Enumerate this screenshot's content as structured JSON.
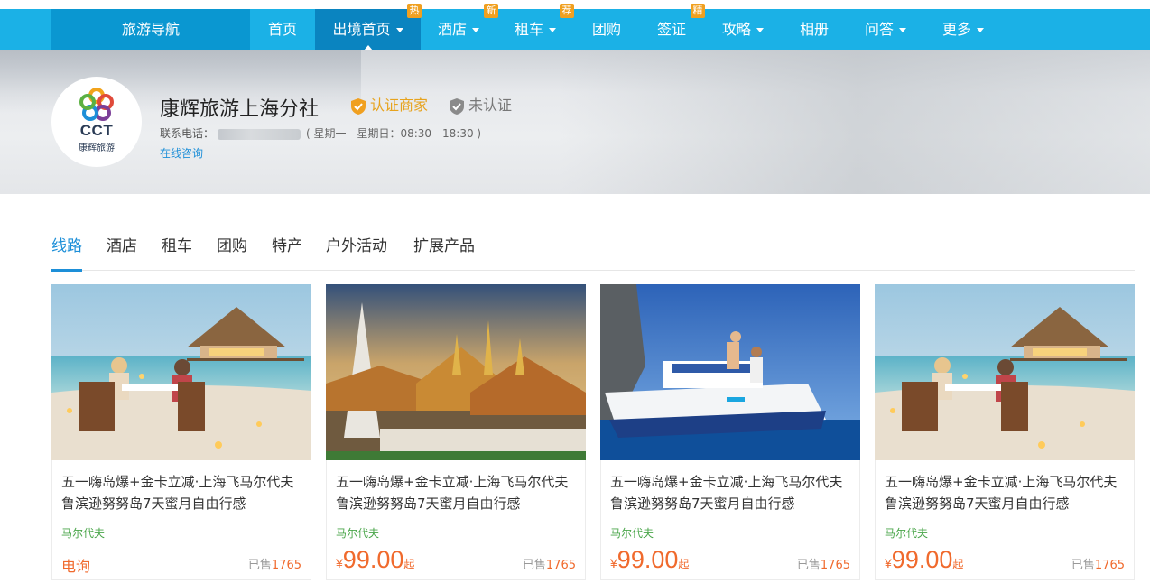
{
  "nav": {
    "brand": "旅游导航",
    "items": [
      {
        "label": "首页",
        "dropdown": false,
        "badge": ""
      },
      {
        "label": "出境首页",
        "dropdown": true,
        "badge": "热",
        "active": true
      },
      {
        "label": "酒店",
        "dropdown": true,
        "badge": "新"
      },
      {
        "label": "租车",
        "dropdown": true,
        "badge": "荐"
      },
      {
        "label": "团购",
        "dropdown": false,
        "badge": ""
      },
      {
        "label": "签证",
        "dropdown": false,
        "badge": "精"
      },
      {
        "label": "攻略",
        "dropdown": true,
        "badge": ""
      },
      {
        "label": "相册",
        "dropdown": false,
        "badge": ""
      },
      {
        "label": "问答",
        "dropdown": true,
        "badge": ""
      },
      {
        "label": "更多",
        "dropdown": true,
        "badge": ""
      }
    ]
  },
  "shop": {
    "logo_big": "CCT",
    "logo_small": "康辉旅游",
    "name": "康辉旅游上海分社",
    "certified_label": "认证商家",
    "uncertified_label": "未认证",
    "phone_label": "联系电话：",
    "hours": "( 星期一 - 星期日：08:30 - 18:30 )",
    "consult_label": "在线咨询"
  },
  "tabs": [
    "线路",
    "酒店",
    "租车",
    "团购",
    "特产",
    "户外活动",
    "扩展产品"
  ],
  "cards": [
    {
      "title": "五一嗨岛爆+金卡立减·上海飞马尔代夫鲁滨逊努努岛7天蜜月自由行感",
      "destination": "马尔代夫",
      "price_text": "电询",
      "sold_label": "已售",
      "sold_count": "1765",
      "image": "beach-dinner"
    },
    {
      "title": "五一嗨岛爆+金卡立减·上海飞马尔代夫鲁滨逊努努岛7天蜜月自由行感",
      "destination": "马尔代夫",
      "currency": "¥",
      "price": "99.00",
      "price_unit": "起",
      "sold_label": "已售",
      "sold_count": "1765",
      "image": "temple"
    },
    {
      "title": "五一嗨岛爆+金卡立减·上海飞马尔代夫鲁滨逊努努岛7天蜜月自由行感",
      "destination": "马尔代夫",
      "currency": "¥",
      "price": "99.00",
      "price_unit": "起",
      "sold_label": "已售",
      "sold_count": "1765",
      "image": "speedboat"
    },
    {
      "title": "五一嗨岛爆+金卡立减·上海飞马尔代夫鲁滨逊努努岛7天蜜月自由行感",
      "destination": "马尔代夫",
      "currency": "¥",
      "price": "99.00",
      "price_unit": "起",
      "sold_label": "已售",
      "sold_count": "1765",
      "image": "beach-dinner"
    }
  ],
  "colors": {
    "nav_bg": "#1bb1e6",
    "nav_brand_bg": "#0a97d1",
    "accent_blue": "#1d8fd8",
    "price_orange": "#f06a2d",
    "badge_orange": "#f0a020",
    "dest_green": "#4aa64a"
  }
}
